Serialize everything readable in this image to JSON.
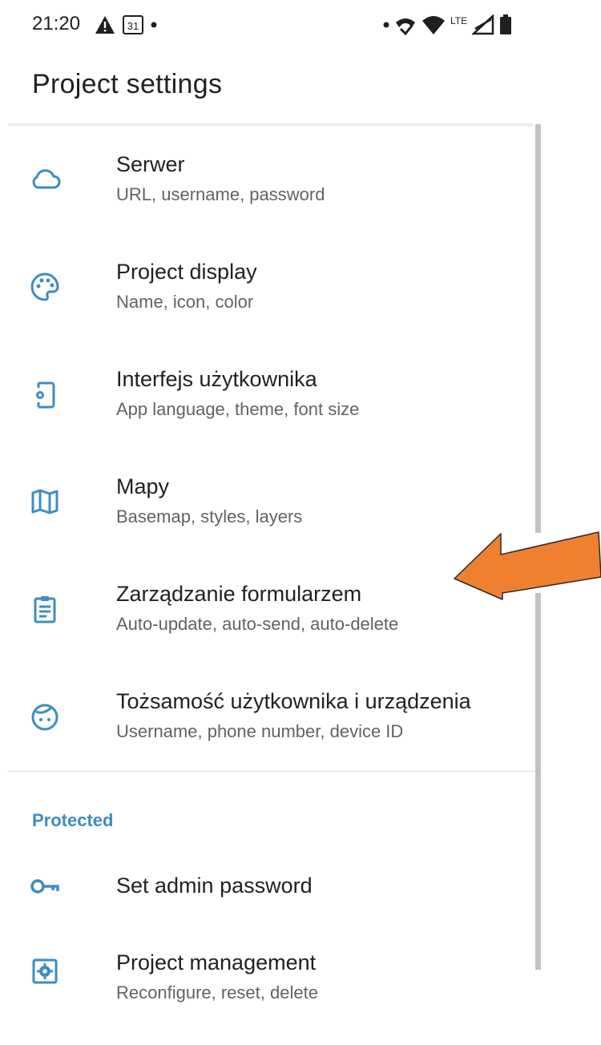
{
  "status_bar": {
    "time": "21:20",
    "left_icons": [
      "warning-icon",
      "calendar-icon",
      "dot"
    ],
    "calendar_day": "31",
    "right_icons": [
      "dot",
      "missed-call-icon",
      "wifi-icon",
      "lte-icon",
      "signal-icon",
      "battery-icon"
    ],
    "network": "LTE"
  },
  "header": {
    "title": "Project settings"
  },
  "items": [
    {
      "label": "Serwer",
      "sub": "URL, username, password",
      "icon": "cloud-icon"
    },
    {
      "label": "Project display",
      "sub": "Name, icon, color",
      "icon": "palette-icon"
    },
    {
      "label": "Interfejs użytkownika",
      "sub": "App language, theme, font size",
      "icon": "phone-settings-icon"
    },
    {
      "label": "Mapy",
      "sub": "Basemap, styles, layers",
      "icon": "map-icon"
    },
    {
      "label": "Zarządzanie formularzem",
      "sub": "Auto-update, auto-send, auto-delete",
      "icon": "clipboard-icon"
    },
    {
      "label": "Tożsamość użytkownika i urządzenia",
      "sub": "Username, phone number, device ID",
      "icon": "face-icon"
    }
  ],
  "protected": {
    "header": "Protected",
    "items": [
      {
        "label": "Set admin password",
        "icon": "key-icon"
      },
      {
        "label": "Project management",
        "sub": "Reconfigure, reset, delete",
        "icon": "settings-box-icon"
      }
    ]
  },
  "colors": {
    "icon": "#3b8dc3",
    "accent": "#3b8dc3",
    "arrow": "#ef8030",
    "text": "#202124",
    "subtext": "#5f6368"
  }
}
